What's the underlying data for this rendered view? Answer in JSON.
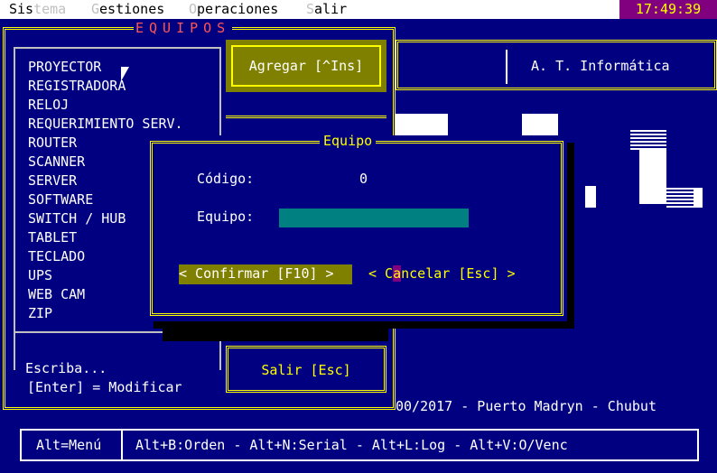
{
  "menu": {
    "items": [
      {
        "hot": "",
        "first": "Sis",
        "rest": "tema",
        "label": "Sistema"
      },
      {
        "label": "Gestiones"
      },
      {
        "label": "Operaciones"
      },
      {
        "label": "Salir"
      }
    ],
    "m1a": "Sis",
    "m1b": "tema",
    "m2a": "G",
    "m2b": "estiones",
    "m3a": "O",
    "m3b": "peraciones",
    "m4a": "S",
    "m4b": "alir"
  },
  "clock": "17:49:39",
  "equipos_window": {
    "title": "EQUIPOS",
    "items": [
      "PROYECTOR",
      "REGISTRADORA",
      "RELOJ",
      "REQUERIMIENTO SERV.",
      "ROUTER",
      "SCANNER",
      "SERVER",
      "SOFTWARE",
      "SWITCH / HUB",
      "TABLET",
      "TECLADO",
      "UPS",
      "WEB CAM",
      "ZIP"
    ],
    "search_label": "Escriba...",
    "enter_hint": "[Enter] = Modificar",
    "add_button": "Agregar [^Ins]",
    "exit_button": "Salir [Esc]"
  },
  "right_panel": {
    "brand": "A. T. Informática",
    "footer": "00/2017 - Puerto Madryn - Chubut"
  },
  "status_bar": {
    "menu_hint": "Alt=Menú",
    "shortcuts": "Alt+B:Orden - Alt+N:Serial - Alt+L:Log - Alt+V:O/Venc"
  },
  "dialog": {
    "title": "Equipo",
    "code_label": "Código:",
    "code_value": "0",
    "equipo_label": "Equipo:",
    "equipo_value": "",
    "confirm_button": "< Confirmar [F10] >",
    "cancel_pre": "< C",
    "cancel_hot": "a",
    "cancel_post": "ncelar [Esc] >"
  },
  "colors": {
    "background": "#000080",
    "frame": "#ffff00",
    "title_red": "#ff5555",
    "button_olive": "#808000",
    "input_teal": "#008080",
    "clock_bg": "#800080"
  }
}
